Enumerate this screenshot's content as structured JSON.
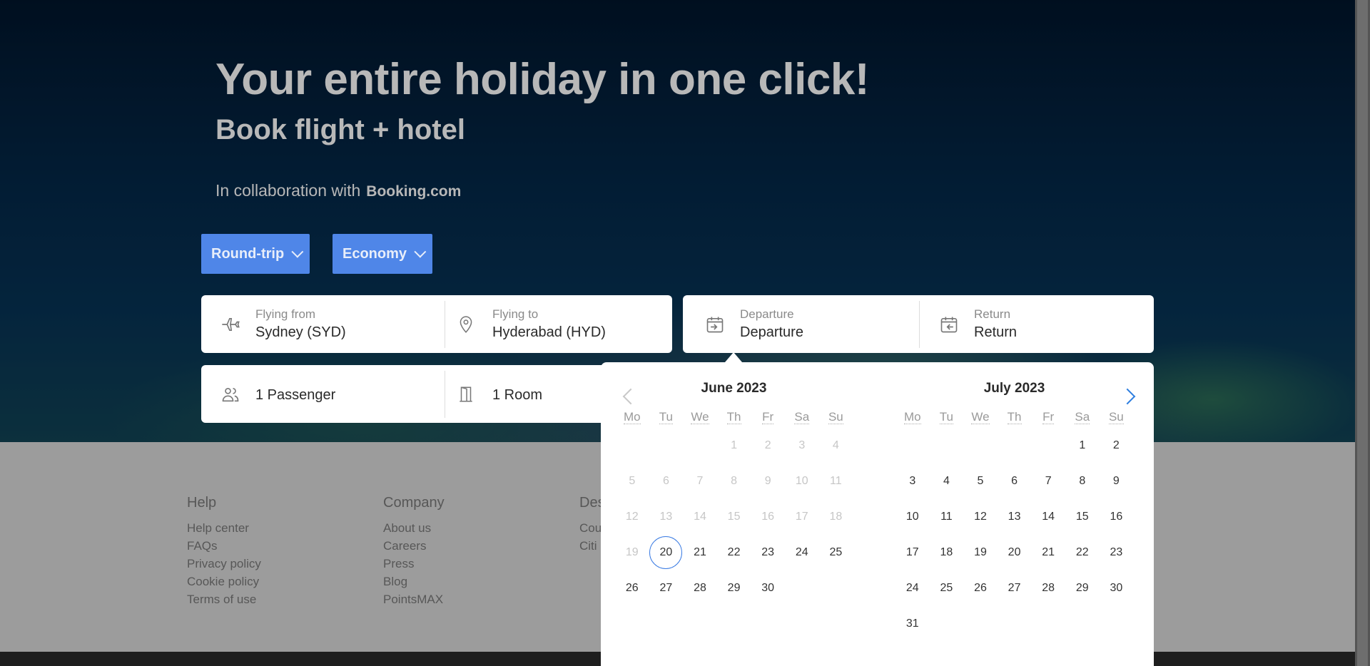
{
  "hero": {
    "headline": "Your entire holiday in one click!",
    "subheadline": "Book flight + hotel",
    "collab_text": "In collaboration with",
    "collab_brand": "Booking.com"
  },
  "trip_type": {
    "label": "Round-trip"
  },
  "cabin_class": {
    "label": "Economy"
  },
  "search": {
    "from": {
      "label": "Flying from",
      "value": "Sydney (SYD)"
    },
    "to": {
      "label": "Flying to",
      "value": "Hyderabad (HYD)"
    },
    "departure": {
      "label": "Departure",
      "value": "Departure"
    },
    "return": {
      "label": "Return",
      "value": "Return"
    },
    "passengers": {
      "value": "1 Passenger"
    },
    "rooms": {
      "value": "1 Room"
    }
  },
  "calendar": {
    "weekdays": [
      "Mo",
      "Tu",
      "We",
      "Th",
      "Fr",
      "Sa",
      "Su"
    ],
    "months": [
      {
        "title": "June 2023",
        "offset": 3,
        "days": 30,
        "muted_until": 19,
        "today": 20
      },
      {
        "title": "July 2023",
        "offset": 5,
        "days": 31,
        "muted_until": 0,
        "today": null
      }
    ]
  },
  "footer": {
    "columns": [
      {
        "title": "Help",
        "links": [
          "Help center",
          "FAQs",
          "Privacy policy",
          "Cookie policy",
          "Terms of use"
        ]
      },
      {
        "title": "Company",
        "links": [
          "About us",
          "Careers",
          "Press",
          "Blog",
          "PointsMAX"
        ]
      },
      {
        "title": "Des",
        "links": [
          "Cou",
          "Citi"
        ]
      }
    ]
  },
  "colors": {
    "accent": "#4f86e8",
    "today_ring": "#3a7be3",
    "next_arrow": "#2f7fe0"
  },
  "icons": [
    "plane-icon",
    "location-pin-icon",
    "calendar-depart-icon",
    "calendar-return-icon",
    "passengers-icon",
    "door-icon",
    "chevron-down-icon",
    "chevron-left-icon",
    "chevron-right-icon"
  ]
}
